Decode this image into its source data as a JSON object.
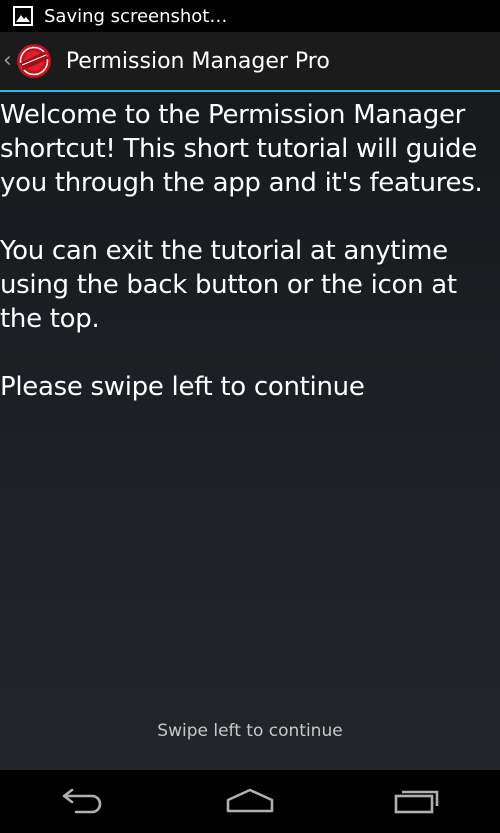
{
  "status_bar": {
    "notification_icon": "image-icon",
    "text": "Saving screenshot…"
  },
  "action_bar": {
    "up_icon": "chevron-left-icon",
    "app_icon": "permission-manager-logo",
    "title": "Permission Manager Pro",
    "accent_color": "#33b5e5"
  },
  "content": {
    "paragraphs": [
      "Welcome to the Permission Manager shortcut! This short tutorial will guide you through the app and it's features.",
      "You can exit the tutorial at anytime using the back button or the icon at the top.",
      "Please swipe left to continue"
    ],
    "swipe_hint": "Swipe left to continue"
  },
  "nav_bar": {
    "back_icon": "back-icon",
    "home_icon": "home-icon",
    "recents_icon": "recents-icon"
  }
}
